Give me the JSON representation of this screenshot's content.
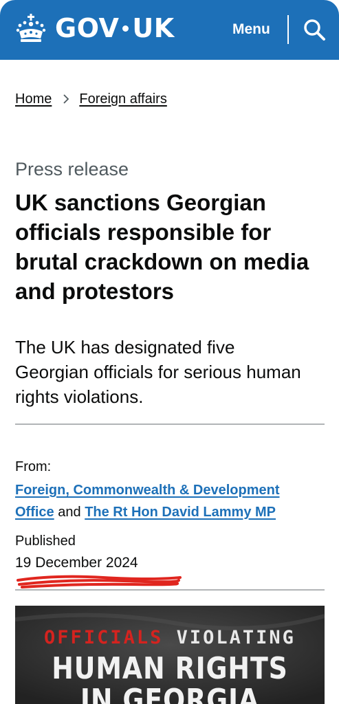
{
  "header": {
    "logo_text_left": "GOV",
    "logo_text_right": "UK",
    "menu_label": "Menu",
    "search_icon": "search-icon",
    "crown_icon": "crown-icon",
    "background_color": "#1d70b8"
  },
  "breadcrumbs": [
    {
      "label": "Home"
    },
    {
      "label": "Foreign affairs"
    }
  ],
  "article": {
    "kicker": "Press release",
    "title": "UK sanctions Georgian officials responsible for brutal crackdown on media and protestors",
    "lead": "The UK has designated five Georgian officials for serious human rights violations."
  },
  "metadata": {
    "from_label": "From:",
    "from_org": "Foreign, Commonwealth & Development Office",
    "from_and": "and",
    "from_person": "The Rt Hon David Lammy MP",
    "published_label": "Published",
    "published_date": "19 December 2024",
    "link_color": "#1d70b8"
  },
  "hero_image": {
    "line1_red": "OFFICIALS",
    "line1_white": "VIOLATING",
    "line2": "HUMAN RIGHTS",
    "line3": "IN GEORGIA",
    "accent_color": "#d4231f"
  }
}
